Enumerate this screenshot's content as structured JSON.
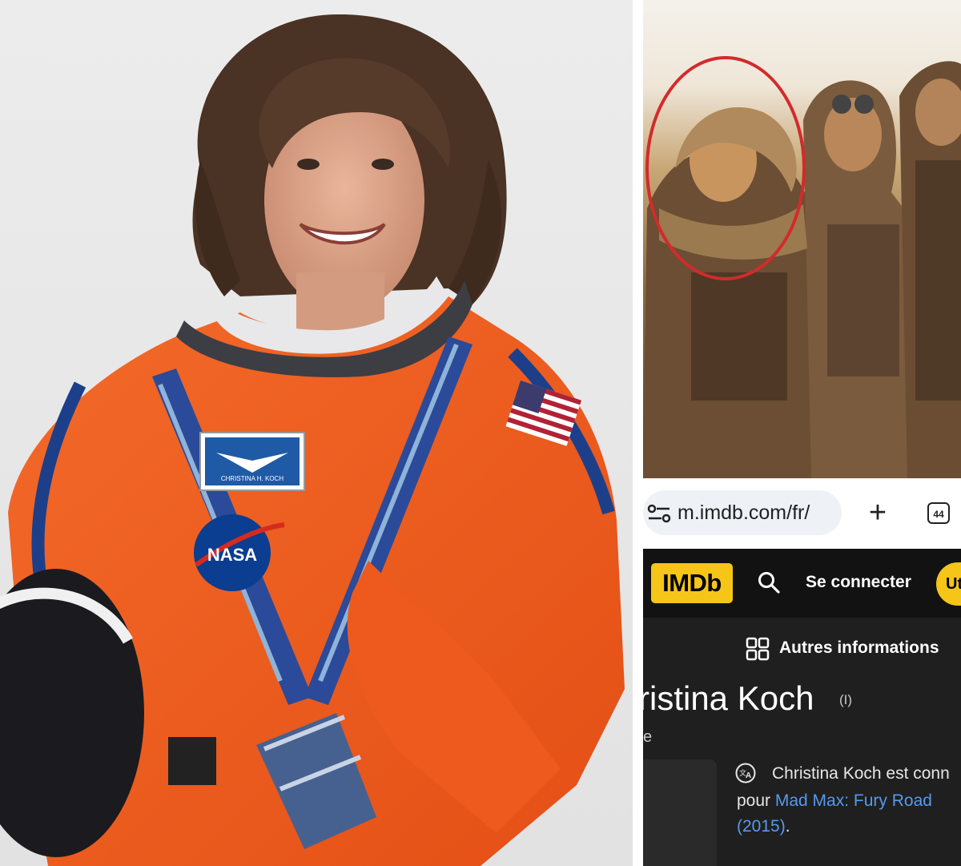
{
  "browser": {
    "url": "m.imdb.com/fr/",
    "new_tab_symbol": "+",
    "tab_count": "44"
  },
  "imdb": {
    "logo": "IMDb",
    "sign_in": "Se connecter",
    "user_button": "Ut",
    "more_info": "Autres informations",
    "name_partial": "ristina Koch",
    "name_suffix": "(I)",
    "subtitle_partial": "e",
    "bio_line1": "Christina Koch est conn",
    "bio_line2_prefix": "pour ",
    "bio_link_title": "Mad Max: Fury Road",
    "bio_link_year": "(2015)",
    "bio_end": "."
  },
  "badge": {
    "name_tape": "CHRISTINA H. KOCH",
    "agency": "NASA"
  },
  "icons": [
    "tune-icon",
    "search-icon",
    "grid-icon",
    "translate-icon",
    "nasa-logo",
    "flag-icon"
  ],
  "colors": {
    "suit_orange": "#f2581e",
    "suit_blue": "#1d3f8a",
    "imdb_yellow": "#f5c518",
    "imdb_bg": "#1f1f1f",
    "link_blue": "#5799ef",
    "circle_red": "#d22b2b"
  }
}
